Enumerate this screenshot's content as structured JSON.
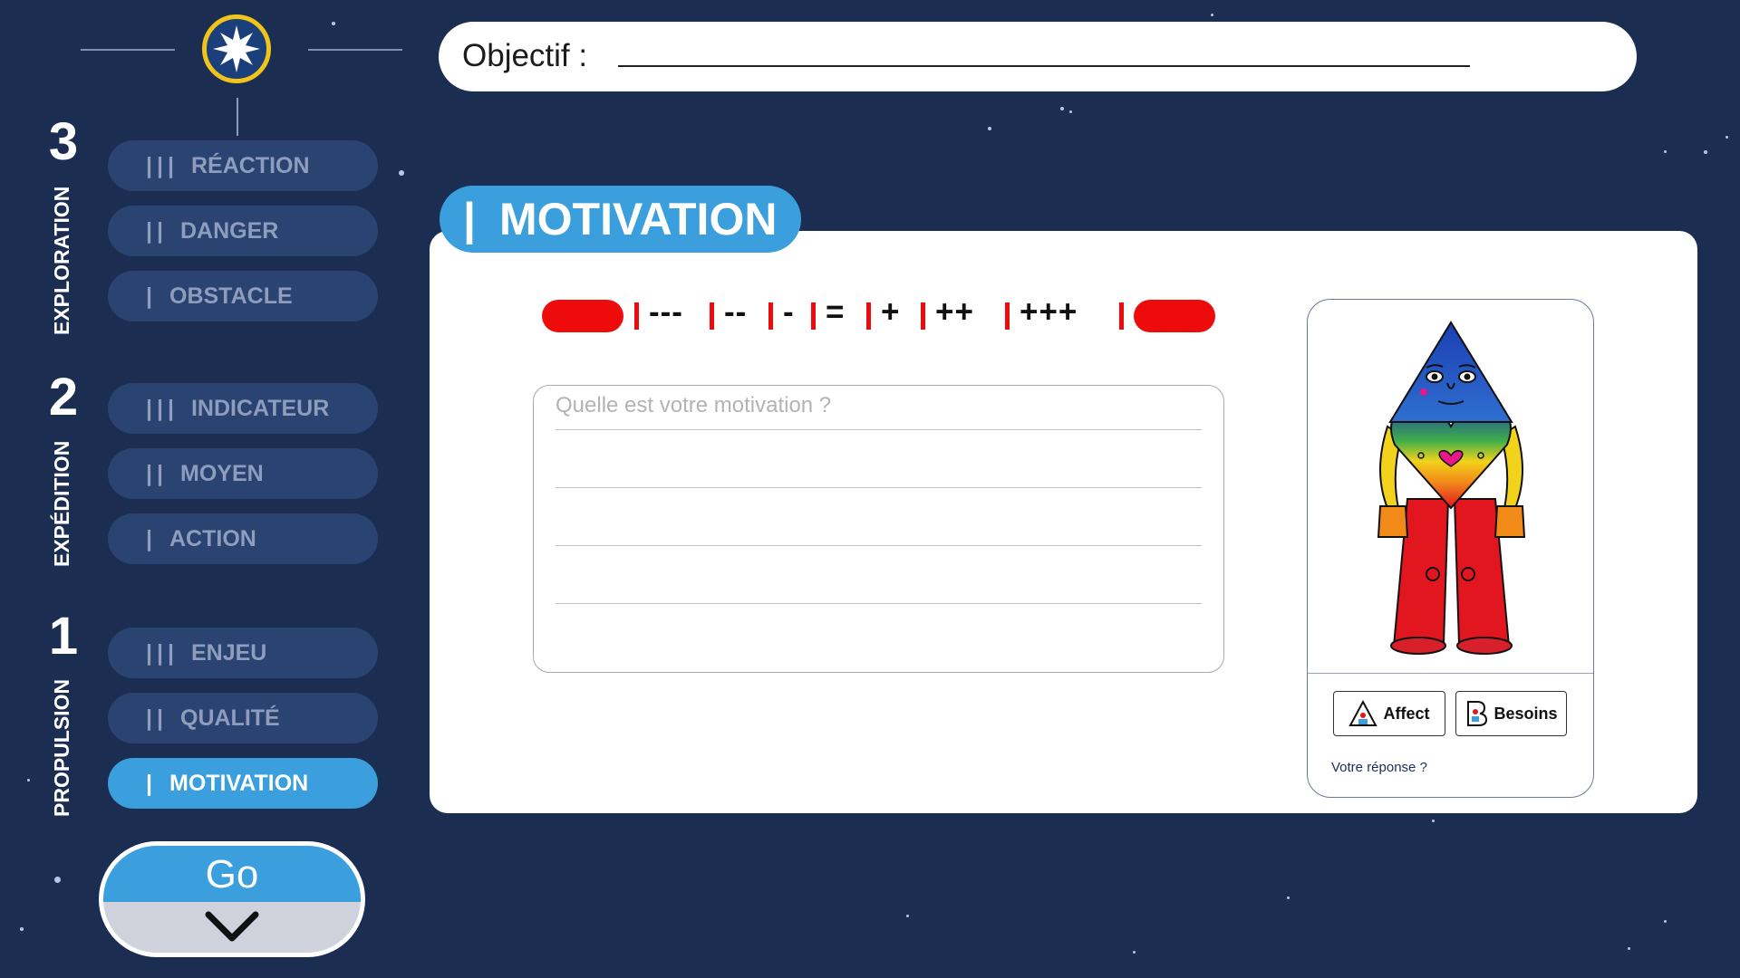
{
  "objective": {
    "label": "Objectif :"
  },
  "sidebar": {
    "sections": [
      {
        "number": "3",
        "label": "EXPLORATION",
        "items": [
          {
            "bars": "|||",
            "label": "RÉACTION"
          },
          {
            "bars": "||",
            "label": "DANGER"
          },
          {
            "bars": "|",
            "label": "OBSTACLE"
          }
        ]
      },
      {
        "number": "2",
        "label": "EXPÉDITION",
        "items": [
          {
            "bars": "|||",
            "label": "INDICATEUR"
          },
          {
            "bars": "||",
            "label": "MOYEN"
          },
          {
            "bars": "|",
            "label": "ACTION"
          }
        ]
      },
      {
        "number": "1",
        "label": "PROPULSION",
        "items": [
          {
            "bars": "|||",
            "label": "ENJEU"
          },
          {
            "bars": "||",
            "label": "QUALITÉ"
          },
          {
            "bars": "|",
            "label": "MOTIVATION"
          }
        ]
      }
    ],
    "active_item": "MOTIVATION",
    "go_button": {
      "label": "Go",
      "icon": "chevron-down-icon"
    }
  },
  "panel": {
    "tab": {
      "bar": "|",
      "title": "MOTIVATION"
    },
    "scale": {
      "labels": [
        "---",
        "--",
        "-",
        "=",
        "+",
        "++",
        "+++"
      ]
    },
    "question": {
      "placeholder": "Quelle est votre motivation ?"
    },
    "card": {
      "buttons": [
        {
          "label": "Affect",
          "icon": "triangle-figure-icon"
        },
        {
          "label": "Besoins",
          "icon": "b-figure-icon"
        }
      ],
      "answer_prompt": "Votre réponse ?"
    }
  },
  "colors": {
    "background": "#1c2d52",
    "accent": "#3a9fdc",
    "scale_red": "#ee0b0b",
    "logo_ring": "#f0c419"
  }
}
